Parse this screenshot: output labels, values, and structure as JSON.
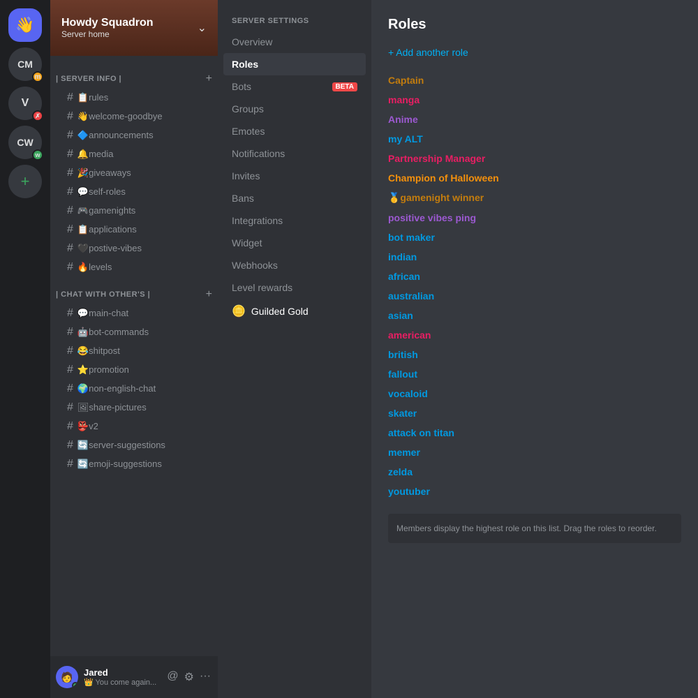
{
  "server_list": {
    "main_server": {
      "emoji": "👋",
      "bg": "#5865f2"
    },
    "other_servers": [
      {
        "id": "cm",
        "label": "CM",
        "badge": "m",
        "badge_color": "yellow"
      },
      {
        "id": "v",
        "label": "V",
        "badge": "✗",
        "badge_color": "red"
      },
      {
        "id": "cw",
        "label": "CW",
        "badge": "w",
        "badge_color": "green"
      }
    ],
    "add_label": "+"
  },
  "server_header": {
    "name": "Howdy Squadron",
    "subtitle": "Server home",
    "chevron": "⌄"
  },
  "channel_categories": [
    {
      "id": "server-info",
      "name": "| Server Info |",
      "channels": [
        {
          "id": "rules",
          "name": "📋rules"
        },
        {
          "id": "welcome-goodbye",
          "name": "👋welcome-goodbye"
        },
        {
          "id": "announcements",
          "name": "🔷announcements"
        },
        {
          "id": "media",
          "name": "🔔media"
        },
        {
          "id": "giveaways",
          "name": "🎉giveaways"
        },
        {
          "id": "self-roles",
          "name": "💬self-roles"
        },
        {
          "id": "gamenights",
          "name": "🎮gamenights"
        },
        {
          "id": "applications",
          "name": "📋applications"
        },
        {
          "id": "postive-vibes",
          "name": "🖤postive-vibes"
        },
        {
          "id": "levels",
          "name": "🔥levels"
        }
      ]
    },
    {
      "id": "chat-with-others",
      "name": "| Chat With other's |",
      "channels": [
        {
          "id": "main-chat",
          "name": "💬main-chat"
        },
        {
          "id": "bot-commands",
          "name": "🤖bot-commands"
        },
        {
          "id": "shitpost",
          "name": "😂shitpost"
        },
        {
          "id": "promotion",
          "name": "⭐promotion"
        },
        {
          "id": "non-english-chat",
          "name": "🌍non-english-chat"
        },
        {
          "id": "share-pictures",
          "name": "🖼share-pictures"
        },
        {
          "id": "v2",
          "name": "👺v2"
        },
        {
          "id": "server-suggestions",
          "name": "🔄server-suggestions"
        },
        {
          "id": "emoji-suggestions",
          "name": "🔄emoji-suggestions"
        }
      ]
    }
  ],
  "user_panel": {
    "name": "Jared",
    "subtitle": "👑 You come again...",
    "avatar_emoji": "👤",
    "status": "online"
  },
  "settings_nav": {
    "items": [
      {
        "id": "server-settings-label",
        "label": "Server settings",
        "active": false,
        "header": true
      },
      {
        "id": "overview",
        "label": "Overview",
        "active": false
      },
      {
        "id": "roles",
        "label": "Roles",
        "active": true
      },
      {
        "id": "bots",
        "label": "Bots",
        "active": false,
        "badge": "BETA"
      },
      {
        "id": "groups",
        "label": "Groups",
        "active": false
      },
      {
        "id": "emotes",
        "label": "Emotes",
        "active": false
      },
      {
        "id": "notifications",
        "label": "Notifications",
        "active": false
      },
      {
        "id": "invites",
        "label": "Invites",
        "active": false
      },
      {
        "id": "bans",
        "label": "Bans",
        "active": false
      },
      {
        "id": "integrations",
        "label": "Integrations",
        "active": false
      },
      {
        "id": "widget",
        "label": "Widget",
        "active": false
      },
      {
        "id": "webhooks",
        "label": "Webhooks",
        "active": false
      },
      {
        "id": "level-rewards",
        "label": "Level rewards",
        "active": false
      },
      {
        "id": "guilded-gold",
        "label": "Guilded Gold",
        "active": false,
        "guilded": true
      }
    ]
  },
  "roles_panel": {
    "title": "Roles",
    "add_role": "+ Add another role",
    "roles": [
      {
        "id": "captain",
        "label": "Captain",
        "color": "#c27c0e"
      },
      {
        "id": "manga",
        "label": "manga",
        "color": "#e91e63"
      },
      {
        "id": "anime",
        "label": "Anime",
        "color": "#9c59d1"
      },
      {
        "id": "my-alt",
        "label": "my ALT",
        "color": "#0099e1"
      },
      {
        "id": "partnership-manager",
        "label": "Partnership Manager",
        "color": "#e91e63"
      },
      {
        "id": "champion-of-halloween",
        "label": "Champion of Halloween",
        "color": "#f4900c"
      },
      {
        "id": "gamenight-winner",
        "label": "🥇gamenight winner",
        "color": "#c27c0e"
      },
      {
        "id": "positive-vibes-ping",
        "label": "positive vibes ping",
        "color": "#9c59d1"
      },
      {
        "id": "bot-maker",
        "label": "bot maker",
        "color": "#0099e1"
      },
      {
        "id": "indian",
        "label": "indian",
        "color": "#0099e1"
      },
      {
        "id": "african",
        "label": "african",
        "color": "#0099e1"
      },
      {
        "id": "australian",
        "label": "australian",
        "color": "#0099e1"
      },
      {
        "id": "asian",
        "label": "asian",
        "color": "#0099e1"
      },
      {
        "id": "american",
        "label": "american",
        "color": "#e91e63"
      },
      {
        "id": "british",
        "label": "british",
        "color": "#0099e1"
      },
      {
        "id": "fallout",
        "label": "fallout",
        "color": "#0099e1"
      },
      {
        "id": "vocaloid",
        "label": "vocaloid",
        "color": "#0099e1"
      },
      {
        "id": "skater",
        "label": "skater",
        "color": "#0099e1"
      },
      {
        "id": "attack-on-titan",
        "label": "attack on titan",
        "color": "#0099e1"
      },
      {
        "id": "memer",
        "label": "memer",
        "color": "#0099e1"
      },
      {
        "id": "zelda",
        "label": "zelda",
        "color": "#0099e1"
      },
      {
        "id": "youtuber",
        "label": "youtuber",
        "color": "#0099e1"
      }
    ],
    "footer": "Members display the highest role on this list. Drag the roles to reorder."
  }
}
